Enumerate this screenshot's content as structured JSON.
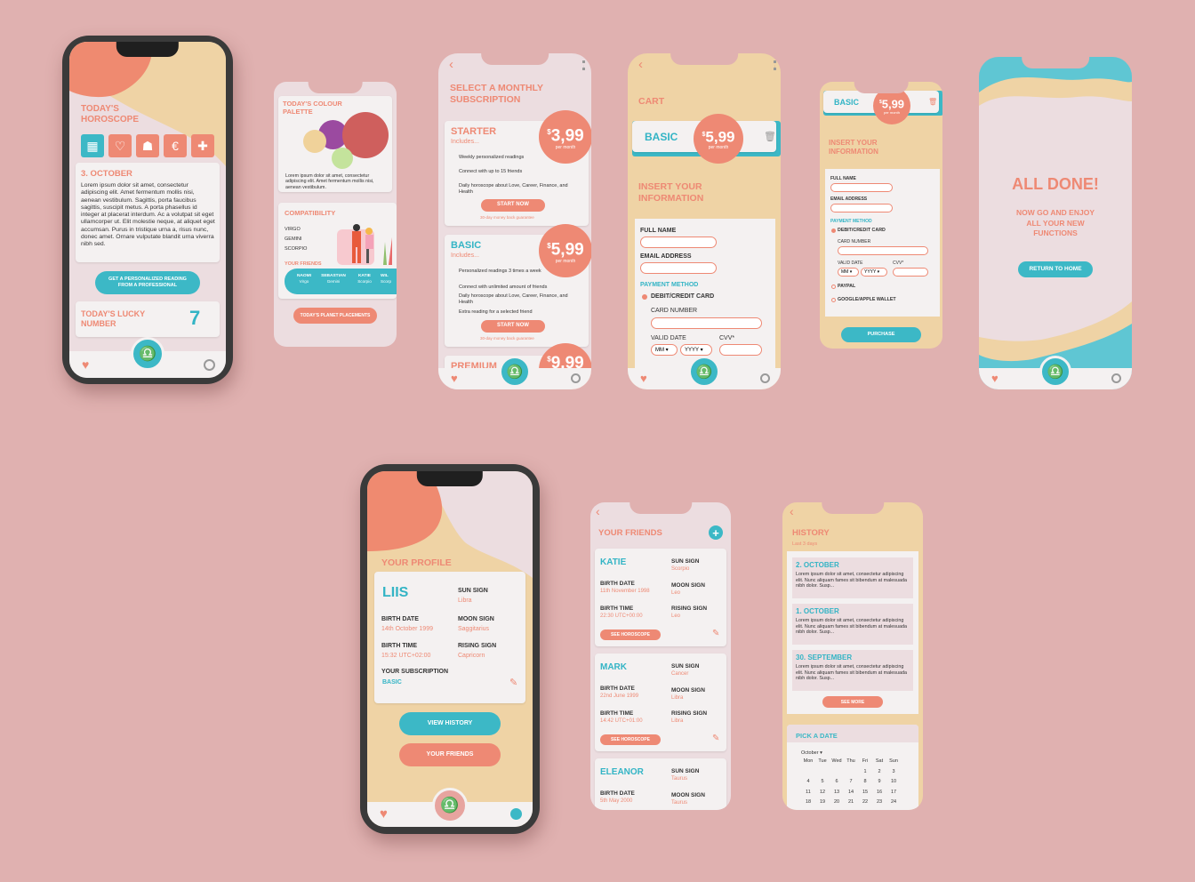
{
  "icons": {
    "heart": "heart-icon",
    "zodiac": "libra-icon",
    "profile": "profile-icon",
    "back": "back-icon",
    "trash": "trash-icon",
    "plus": "plus-icon",
    "edit": "pencil-icon"
  },
  "colors": {
    "background": "#e0b1b0",
    "orange": "#ee8974",
    "teal": "#3cb8c6",
    "sand": "#efd3a5",
    "pink": "#ecdde0"
  },
  "horoscope": {
    "title": "TODAY'S HOROSCOPE",
    "date": "3. OCTOBER",
    "text": "Lorem ipsum dolor sit amet, consectetur adipiscing elit. Amet fermentum mollis nisi, aenean vestibulum. Sagittis, porta faucibus sagittis, suscipit metus. A porta phasellus id integer at placerat interdum. Ac a volutpat sit eget ullamcorper ut. Elit molestie neque, at aliquet eget accumsan. Purus in tristique urna a, risus nunc, donec amet. Ornare vulputate blandit urna viverra nibh sed.",
    "button": "GET A PERSONALIZED READING FROM A PROFESSIONAL",
    "lucky_label": "TODAY'S LUCKY NUMBER",
    "lucky_number": "7"
  },
  "palette": {
    "title": "TODAY'S COLOUR PALETTE",
    "text": "Lorem ipsum dolor sit amet, consectetur adipiscing elit. Amet fermentum mollis nisi, aenean vestibulum.",
    "compat_title": "COMPATIBILITY",
    "signs": [
      "VIRGO",
      "GEMINI",
      "SCORPIO"
    ],
    "friends_title": "YOUR FRIENDS",
    "friends": [
      {
        "name": "NAOMI",
        "sign": "Virgo"
      },
      {
        "name": "SEBASTIAN",
        "sign": "Gemini"
      },
      {
        "name": "KATIE",
        "sign": "Scorpio"
      },
      {
        "name": "WIL",
        "sign": "Scorp"
      }
    ],
    "button": "TODAY'S PLANET PLACEMENTS"
  },
  "subscription": {
    "title": "SELECT A MONTHLY SUBSCRIPTION",
    "plans": [
      {
        "name": "STARTER",
        "includes": "Includes...",
        "price": "3,99",
        "per": "per month",
        "features": [
          "Weekly personalized readings",
          "Connect with up to 15 friends",
          "Daily horoscope about Love, Career, Finance, and Health"
        ],
        "button": "START NOW",
        "guarantee": "30-day money back guarantee"
      },
      {
        "name": "BASIC",
        "includes": "Includes...",
        "price": "5,99",
        "per": "per month",
        "features": [
          "Personalized readings 3 times a week",
          "Connect with unlimited amount of friends",
          "Daily horoscope about Love, Career, Finance, and Health",
          "Extra reading for a selected friend"
        ],
        "button": "START NOW",
        "guarantee": "30-day money back guarantee"
      },
      {
        "name": "PREMIUM",
        "price": "9,99"
      }
    ],
    "currency": "$"
  },
  "cart": {
    "title": "CART",
    "item": "BASIC",
    "price": "5,99",
    "per": "per month",
    "currency": "$",
    "insert": "INSERT YOUR INFORMATION",
    "full_name": "FULL NAME",
    "email": "EMAIL ADDRESS",
    "payment": "PAYMENT METHOD",
    "debit": "DEBIT/CREDIT CARD",
    "card": "CARD NUMBER",
    "valid": "VALID DATE",
    "cvv": "CVV*",
    "mm": "MM",
    "yyyy": "YYYY"
  },
  "cart2": {
    "item": "BASIC",
    "price": "5,99",
    "per": "per month",
    "currency": "$",
    "insert": "INSERT YOUR INFORMATION",
    "full_name": "FULL NAME",
    "email": "EMAIL ADDRESS",
    "payment": "PAYMENT METHOD",
    "debit": "DEBIT/CREDIT CARD",
    "card": "CARD NUMBER",
    "valid": "VALID DATE",
    "cvv": "CVV*",
    "mm": "MM",
    "yyyy": "YYYY",
    "paypal": "PAYPAL",
    "wallet": "GOOGLE/APPLE WALLET",
    "button": "PURCHASE"
  },
  "done": {
    "title": "ALL DONE!",
    "text": "NOW GO AND ENJOY ALL YOUR NEW FUNCTIONS",
    "button": "RETURN TO HOME"
  },
  "profile": {
    "title": "YOUR PROFILE",
    "name": "LIIS",
    "sun_label": "SUN SIGN",
    "sun": "Libra",
    "birth_date_label": "BIRTH DATE",
    "birth_date": "14th October 1999",
    "moon_label": "MOON SIGN",
    "moon": "Saggitarius",
    "birth_time_label": "BIRTH TIME",
    "birth_time": "15:32  UTC+02:00",
    "rising_label": "RISING SIGN",
    "rising": "Capricorn",
    "sub_label": "YOUR SUBSCRIPTION",
    "sub": "BASIC",
    "history_btn": "VIEW HISTORY",
    "friends_btn": "YOUR FRIENDS"
  },
  "friends": {
    "title": "YOUR FRIENDS",
    "birth_date_label": "BIRTH DATE",
    "birth_time_label": "BIRTH TIME",
    "sun_label": "SUN SIGN",
    "moon_label": "MOON SIGN",
    "rising_label": "RISING SIGN",
    "button": "SEE HOROSCOPE",
    "list": [
      {
        "name": "KATIE",
        "birth_date": "11th November 1998",
        "birth_time": "22:30  UTC+00:00",
        "sun": "Scorpio",
        "moon": "Leo",
        "rising": "Leo"
      },
      {
        "name": "MARK",
        "birth_date": "22nd June 1999",
        "birth_time": "14:42  UTC+01:00",
        "sun": "Cancer",
        "moon": "Libra",
        "rising": "Libra"
      },
      {
        "name": "ELEANOR",
        "birth_date": "5th May 2000",
        "sun": "Taurus",
        "moon": "Taurus"
      }
    ]
  },
  "history": {
    "title": "HISTORY",
    "sub": "Last 3 days",
    "entries": [
      {
        "date": "2. OCTOBER",
        "text": "Lorem ipsum dolor sit amet, consectetur adipiscing elit. Nunc aliquam fames sit bibendum at malesuada nibh dolor. Susp..."
      },
      {
        "date": "1. OCTOBER",
        "text": "Lorem ipsum dolor sit amet, consectetur adipiscing elit. Nunc aliquam fames sit bibendum at malesuada nibh dolor. Susp..."
      },
      {
        "date": "30. SEPTEMBER",
        "text": "Lorem ipsum dolor sit amet, consectetur adipiscing elit. Nunc aliquam fames sit bibendum at malesuada nibh dolor. Susp..."
      }
    ],
    "button": "SEE MORE",
    "pick": "PICK A DATE",
    "month": "October",
    "weekdays": [
      "Mon",
      "Tue",
      "Wed",
      "Thu",
      "Fri",
      "Sat",
      "Sun"
    ],
    "days": [
      "",
      "",
      "",
      "",
      "1",
      "2",
      "3",
      "4",
      "5",
      "6",
      "7",
      "8",
      "9",
      "10",
      "11",
      "12",
      "13",
      "14",
      "15",
      "16",
      "17",
      "18",
      "19",
      "20",
      "21",
      "22",
      "23",
      "24"
    ]
  }
}
